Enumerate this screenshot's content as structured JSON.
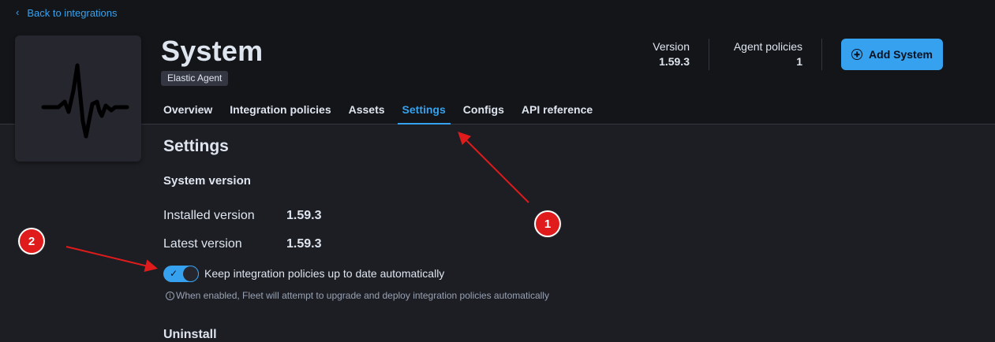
{
  "nav": {
    "back_label": "Back to integrations"
  },
  "integration": {
    "title": "System",
    "badge": "Elastic Agent"
  },
  "stats": {
    "version_label": "Version",
    "version_value": "1.59.3",
    "policies_label": "Agent policies",
    "policies_value": "1"
  },
  "actions": {
    "add_label": "Add System"
  },
  "tabs": [
    {
      "label": "Overview"
    },
    {
      "label": "Integration policies"
    },
    {
      "label": "Assets"
    },
    {
      "label": "Settings",
      "active": true
    },
    {
      "label": "Configs"
    },
    {
      "label": "API reference"
    }
  ],
  "settings": {
    "heading": "Settings",
    "system_version_heading": "System version",
    "installed_label": "Installed version",
    "installed_value": "1.59.3",
    "latest_label": "Latest version",
    "latest_value": "1.59.3",
    "toggle_label": "Keep integration policies up to date automatically",
    "toggle_enabled": true,
    "help_text": "When enabled, Fleet will attempt to upgrade and deploy integration policies automatically",
    "uninstall_heading": "Uninstall"
  },
  "annotations": {
    "marker1": "1",
    "marker2": "2"
  },
  "colors": {
    "accent": "#36a2ef",
    "background": "#1d1e24",
    "header": "#141519",
    "annotation": "#e01b1b"
  },
  "icons": {
    "logo": "heartbeat-pulse-icon",
    "back": "chevron-left-icon",
    "add": "plus-circle-icon",
    "info": "info-icon",
    "check": "check-icon"
  }
}
